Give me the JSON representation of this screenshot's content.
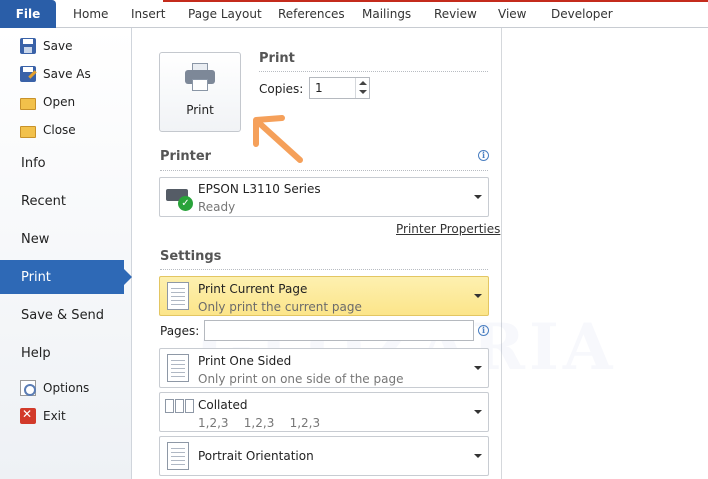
{
  "ribbon": {
    "file_tab": "File",
    "tabs": [
      "Home",
      "Insert",
      "Page Layout",
      "References",
      "Mailings",
      "Review",
      "View",
      "Developer"
    ]
  },
  "nav": {
    "commands_top": [
      {
        "label": "Save",
        "icon": "save-icon"
      },
      {
        "label": "Save As",
        "icon": "save-as-icon"
      },
      {
        "label": "Open",
        "icon": "open-folder-icon"
      },
      {
        "label": "Close",
        "icon": "close-folder-icon"
      }
    ],
    "tabs": [
      "Info",
      "Recent",
      "New",
      "Print",
      "Save & Send",
      "Help"
    ],
    "active_tab": "Print",
    "commands_bottom": [
      {
        "label": "Options",
        "icon": "options-icon"
      },
      {
        "label": "Exit",
        "icon": "exit-icon"
      }
    ]
  },
  "print_section": {
    "title": "Print",
    "button_label": "Print",
    "copies_label": "Copies:",
    "copies_value": "1"
  },
  "printer_section": {
    "title": "Printer",
    "name": "EPSON L3110 Series",
    "status": "Ready",
    "properties_link": "Printer Properties"
  },
  "settings_section": {
    "title": "Settings",
    "print_range": {
      "main": "Print Current Page",
      "sub": "Only print the current page"
    },
    "pages_label": "Pages:",
    "pages_value": "",
    "sides": {
      "main": "Print One Sided",
      "sub": "Only print on one side of the page"
    },
    "collation": {
      "main": "Collated",
      "sub": "1,2,3    1,2,3    1,2,3"
    },
    "orientation": {
      "main": "Portrait Orientation"
    }
  },
  "watermark": "GLOZARIA",
  "colors": {
    "file_tab": "#2a5ea8",
    "active_nav": "#2e69b6",
    "highlight": "#fce58a",
    "annotation_arrow": "#f5a05a"
  }
}
